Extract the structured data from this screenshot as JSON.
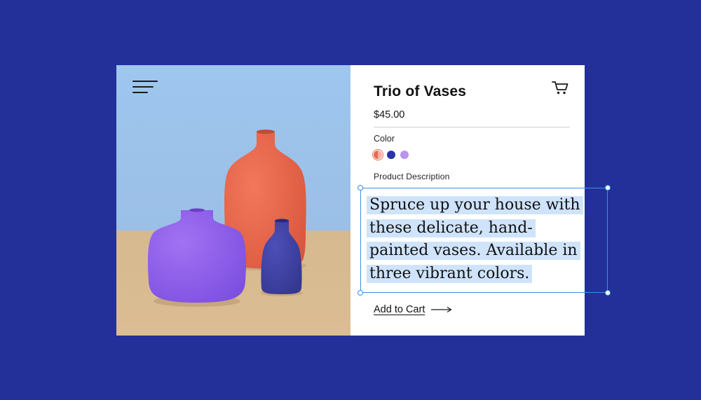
{
  "product": {
    "title": "Trio of Vases",
    "price": "$45.00",
    "color_label": "Color",
    "colors": [
      {
        "name": "coral",
        "hex": "#e9674f",
        "selected": true
      },
      {
        "name": "navy",
        "hex": "#2a34a8",
        "selected": false
      },
      {
        "name": "lavender",
        "hex": "#b894f0",
        "selected": false
      }
    ],
    "description_label": "Product Description",
    "description_lines": [
      "Spruce up your house with",
      "these delicate, hand-",
      "painted vases. Available in",
      "three vibrant colors."
    ],
    "add_to_cart": "Add to Cart"
  },
  "icons": {
    "menu": "hamburger-menu-icon",
    "cart": "shopping-cart-icon",
    "arrow": "arrow-right-icon"
  },
  "theme": {
    "background": "#23309a",
    "selection_highlight": "#cfe3fb",
    "selection_border": "#3b8eea",
    "sky": "#9cc3ec",
    "floor": "#d9b88e"
  }
}
